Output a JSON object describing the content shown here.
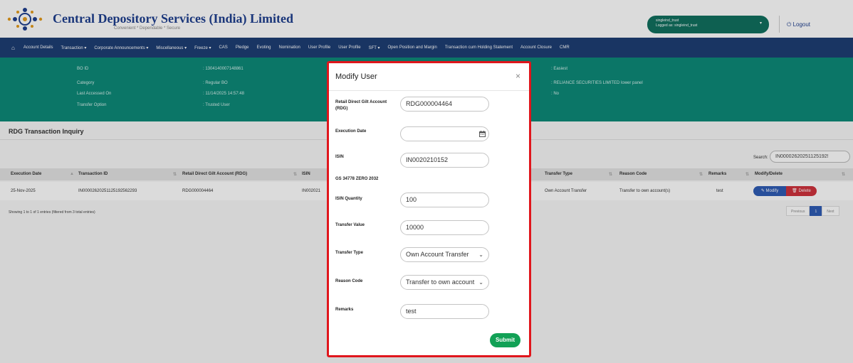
{
  "header": {
    "title": "Central Depository Services (India) Limited",
    "tagline": "Convenient  *  Dependable  *  Secure",
    "user_name": "singleind_trust",
    "logged_as": "Logged as: singleind_trust",
    "logout_label": "Logout"
  },
  "nav": {
    "items": [
      "Account Details",
      "Transaction ▾",
      "Corporate Announcements ▾",
      "Miscellaneous ▾",
      "Freeze ▾",
      "CAS",
      "Pledge",
      "Evoting",
      "Nomination",
      "User Profile",
      "User Profile",
      "SFT ▾",
      "Open Position and Margin",
      "Transaction cum Holding Statement",
      "Account Closure",
      "CMR"
    ]
  },
  "info": {
    "left": [
      {
        "label": "BO ID",
        "value": ": 1304140007148861"
      },
      {
        "label": "Category",
        "value": ": Regular BO"
      },
      {
        "label": "Last Accessed On",
        "value": ": 11/14/2025 14:57:48"
      },
      {
        "label": "Transfer Option",
        "value": ": Trusted User"
      }
    ],
    "right": [
      ": Easiest",
      ": RELIANCE SECURITIES LIMITED lower panel",
      ": No"
    ]
  },
  "page": {
    "heading": "RDG Transaction Inquiry",
    "search_label": "Search:",
    "search_value": "IN00002620251125192!",
    "table_info": "Showing 1 to 1 of 1 entries (filtered from 3 total entries)",
    "pager": {
      "previous": "Previous",
      "current": "1",
      "next": "Next"
    }
  },
  "table": {
    "columns": [
      "Execution Date",
      "Transaction ID",
      "Retail Direct Gilt Account (RDG)",
      "ISIN",
      "Transfer Type",
      "Reason Code",
      "Remarks",
      "Modify/Delete"
    ],
    "row": {
      "execution_date": "25-Nov-2025",
      "transaction_id": "IN00002620251125192562293",
      "rdg": "RDG000004464",
      "isin": "IN002021",
      "transfer_type": "Own Account Transfer",
      "reason_code": "Transfer to own account(s)",
      "remarks": "test",
      "modify_label": "Modify",
      "delete_label": "Delete"
    }
  },
  "modal": {
    "title": "Modify User",
    "close_glyph": "×",
    "fields": {
      "rdg_label": "Retail Direct Gilt Account (RDG)",
      "rdg_value": "RDG000004464",
      "exec_date_label": "Execution Date",
      "exec_date_value": "",
      "isin_label": "ISIN",
      "isin_value": "IN0020210152",
      "isin_description": "GS 34778 ZERO 2032",
      "qty_label": "ISIN Quantity",
      "qty_value": "100",
      "value_label": "Transfer Value",
      "value_value": "10000",
      "type_label": "Transfer Type",
      "type_value": "Own Account Transfer",
      "reason_label": "Reason Code",
      "reason_value": "Transfer to own account",
      "remarks_label": "Remarks",
      "remarks_value": "test"
    },
    "submit_label": "Submit"
  },
  "colors": {
    "brand_blue": "#1f3f8f",
    "nav_bg": "#1e3e74",
    "info_teal": "#0d8a79",
    "submit_green": "#12a156",
    "highlight_red": "#e0161c"
  }
}
